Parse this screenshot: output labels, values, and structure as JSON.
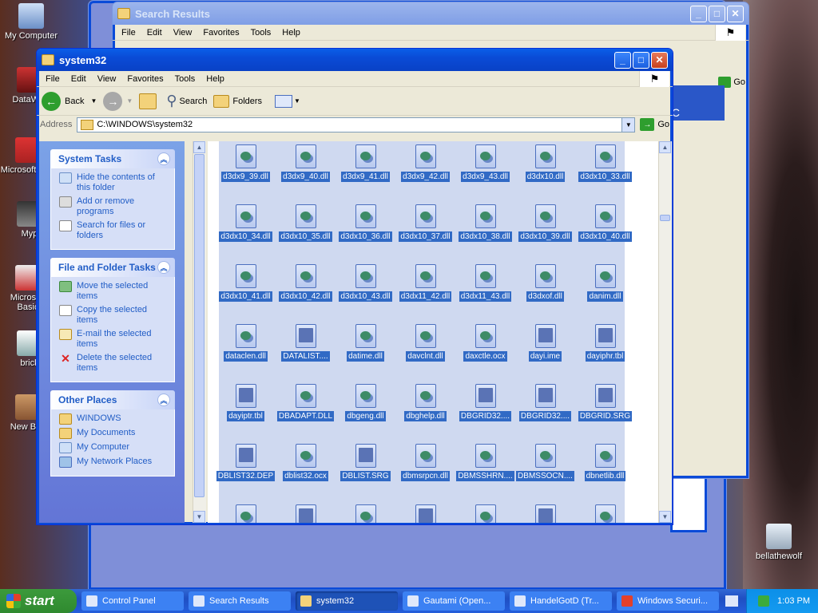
{
  "desktop": {
    "icons": [
      {
        "label": "My Computer"
      },
      {
        "label": "DataWar"
      },
      {
        "label": "Microsoft C++"
      },
      {
        "label": "Myp"
      },
      {
        "label": "Microsoft Basic"
      },
      {
        "label": "brick"
      },
      {
        "label": "New Brie"
      },
      {
        "label": "bellathewolf"
      }
    ]
  },
  "search_window": {
    "title": "Search Results",
    "menu": [
      "File",
      "Edit",
      "View",
      "Favorites",
      "Tools",
      "Help"
    ],
    "go_label": "Go",
    "partial_banner_text": "er",
    "partial_banner_sub": "r PC"
  },
  "explorer": {
    "title": "system32",
    "menu": [
      "File",
      "Edit",
      "View",
      "Favorites",
      "Tools",
      "Help"
    ],
    "toolbar": {
      "back": "Back",
      "search": "Search",
      "folders": "Folders"
    },
    "address_label": "Address",
    "address_value": "C:\\WINDOWS\\system32",
    "go_label": "Go",
    "system_tasks": {
      "title": "System Tasks",
      "items": [
        "Hide the contents of this folder",
        "Add or remove programs",
        "Search for files or folders"
      ]
    },
    "file_tasks": {
      "title": "File and Folder Tasks",
      "items": [
        "Move the selected items",
        "Copy the selected items",
        "E-mail the selected items",
        "Delete the selected items"
      ]
    },
    "other_places": {
      "title": "Other Places",
      "items": [
        "WINDOWS",
        "My Documents",
        "My Computer",
        "My Network Places"
      ]
    },
    "files": [
      [
        "d3dx9_39.dll",
        "d3dx9_40.dll",
        "d3dx9_41.dll",
        "d3dx9_42.dll",
        "d3dx9_43.dll",
        "d3dx10.dll",
        "d3dx10_33.dll"
      ],
      [
        "d3dx10_34.dll",
        "d3dx10_35.dll",
        "d3dx10_36.dll",
        "d3dx10_37.dll",
        "d3dx10_38.dll",
        "d3dx10_39.dll",
        "d3dx10_40.dll"
      ],
      [
        "d3dx10_41.dll",
        "d3dx10_42.dll",
        "d3dx10_43.dll",
        "d3dx11_42.dll",
        "d3dx11_43.dll",
        "d3dxof.dll",
        "danim.dll"
      ],
      [
        "dataclen.dll",
        "DATALIST....",
        "datime.dll",
        "davclnt.dll",
        "daxctle.ocx",
        "dayi.ime",
        "dayiphr.tbl"
      ],
      [
        "dayiptr.tbl",
        "DBADAPT.DLL",
        "dbgeng.dll",
        "dbghelp.dll",
        "DBGRID32....",
        "DBGRID32....",
        "DBGRID.SRG"
      ],
      [
        "DBLIST32.DEP",
        "dblist32.ocx",
        "DBLIST.SRG",
        "dbmsrpcn.dll",
        "DBMSSHRN....",
        "DBMSSOCN....",
        "dbnetlib.dll"
      ]
    ]
  },
  "taskbar": {
    "start_label": "start",
    "tasks": [
      "Control Panel",
      "Search Results",
      "system32",
      "Gautami (Open...",
      "HandelGotD (Tr...",
      "Windows Securi..."
    ],
    "active_task": "system32",
    "clock": "1:03 PM"
  }
}
